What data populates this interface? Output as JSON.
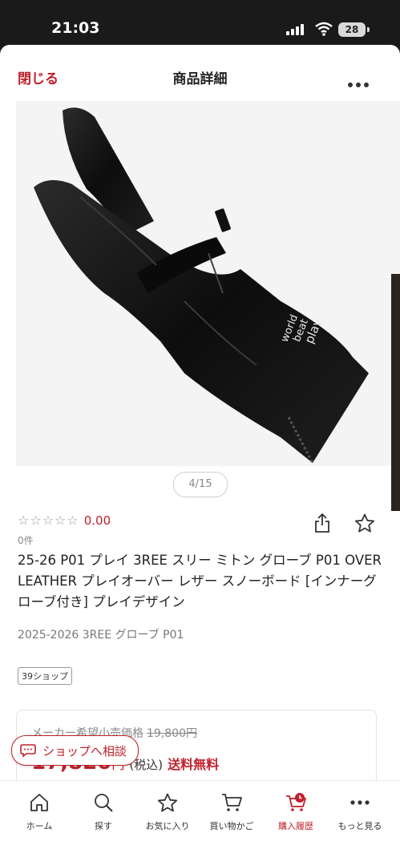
{
  "status_bar": {
    "time": "21:03",
    "battery": "28"
  },
  "header": {
    "close_label": "閉じる",
    "title": "商品詳細",
    "more_icon": "more-horizontal-icon"
  },
  "gallery": {
    "counter": "4/15"
  },
  "product": {
    "rating": 0.0,
    "rating_text": "0.00",
    "stars_text": "☆☆☆☆☆",
    "review_count": "0件",
    "title": "25-26 P01 プレイ 3REE スリー ミトン グローブ P01 OVER LEATHER プレイオーバー レザー スノーボード [インナーグローブ付き] プレイデザイン",
    "subtitle": "2025-2026 3REE グローブ P01",
    "shop_badge": "39ショップ",
    "glove_print": [
      "world",
      "beat",
      "play"
    ]
  },
  "price": {
    "list_label": "メーカー希望小売価格",
    "list_value": "19,800円",
    "sale_value": "17,820",
    "sale_unit": "円",
    "tax_label": "(税込)",
    "shipping": "送料無料"
  },
  "consult_button": {
    "label": "ショップへ相談"
  },
  "tabbar": {
    "items": [
      {
        "label": "ホーム",
        "icon": "home-icon"
      },
      {
        "label": "探す",
        "icon": "search-icon"
      },
      {
        "label": "お気に入り",
        "icon": "star-icon"
      },
      {
        "label": "買い物かご",
        "icon": "cart-icon"
      },
      {
        "label": "購入履歴",
        "icon": "purchase-history-icon"
      },
      {
        "label": "もっと見る",
        "icon": "more-horizontal-icon"
      }
    ],
    "active_index": 4
  },
  "colors": {
    "accent": "#c0212a",
    "text": "#222222",
    "muted": "#888888"
  }
}
